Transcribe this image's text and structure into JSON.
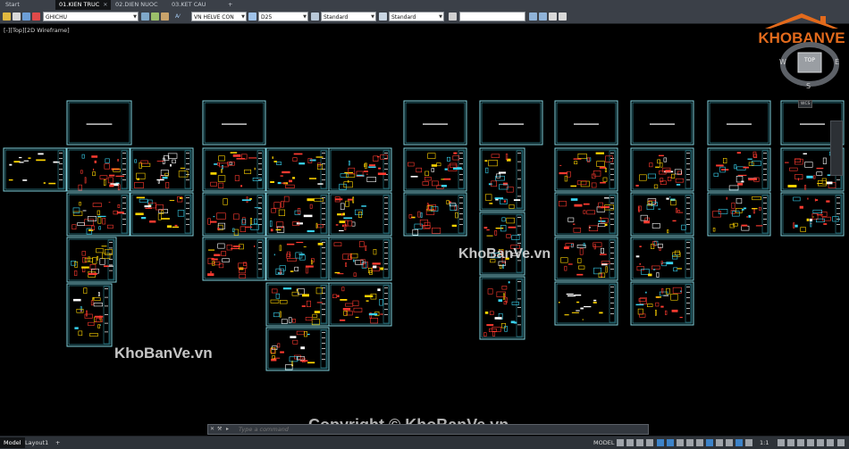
{
  "tabs": [
    {
      "label": "Start",
      "active": false
    },
    {
      "label": "01.KIEN TRUC",
      "active": true
    },
    {
      "label": "02.DIEN NUOC",
      "active": false
    },
    {
      "label": "03.KET CAU",
      "active": false
    },
    {
      "label": "+",
      "active": false
    }
  ],
  "toolbar": {
    "layer_value": "GHICHU",
    "text_style_value": "VN HELVE CON",
    "dim_style_value": "D25",
    "table_style_value": "Standard",
    "multileader_style_value": "Standard"
  },
  "viewport_label": "[-][Top][2D Wireframe]",
  "viewcube": {
    "top": "TOP",
    "west": "W",
    "east": "E",
    "south": "S",
    "ucs": "WCS"
  },
  "logo": {
    "text": "KHOBANVE"
  },
  "watermarks": [
    "KhoBanVe.vn",
    "KhoBanVe.vn",
    "Copyright © KhoBanVe.vn"
  ],
  "command_line": {
    "placeholder": "Type a command"
  },
  "status": {
    "model_tab": "Model",
    "layout_tab": "Layout1",
    "layout_add": "+",
    "model_label": "MODEL",
    "scale": "1:1"
  },
  "colors": {
    "sheet_border": "#7fd3e0",
    "drawing_red": "#ff3b30",
    "drawing_yellow": "#ffd400",
    "drawing_cyan": "#39d3f0",
    "drawing_white": "#ffffff"
  },
  "icons": [
    "sun-icon",
    "layer-icon",
    "text-style-icon",
    "dim-style-icon",
    "table-style-icon",
    "multileader-icon",
    "close-icon",
    "search-icon",
    "grid-icon",
    "snap-icon",
    "ortho-icon",
    "polar-icon",
    "gear-icon"
  ]
}
